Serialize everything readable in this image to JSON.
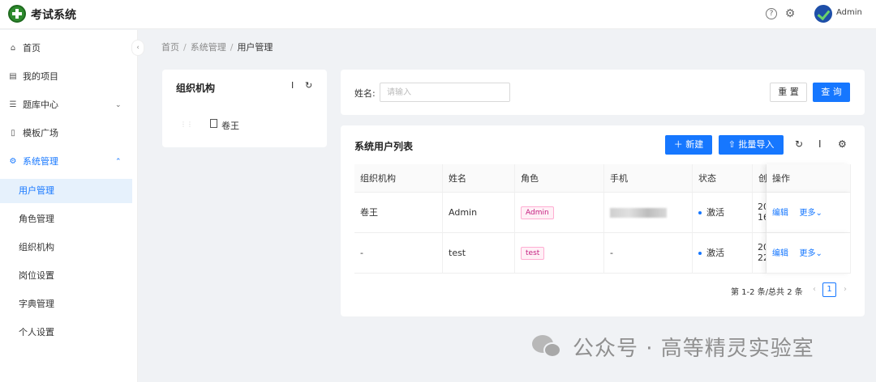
{
  "header": {
    "app_title": "考试系统",
    "user_name": "Admin",
    "help_icon": "help-circle-icon",
    "settings_icon": "gear-icon"
  },
  "sidebar": {
    "items": [
      {
        "label": "首页",
        "icon": "home-icon"
      },
      {
        "label": "我的项目",
        "icon": "project-icon"
      },
      {
        "label": "题库中心",
        "icon": "question-bank-icon"
      },
      {
        "label": "模板广场",
        "icon": "template-icon"
      },
      {
        "label": "系统管理",
        "icon": "settings-icon"
      }
    ],
    "sub_items": [
      {
        "label": "用户管理"
      },
      {
        "label": "角色管理"
      },
      {
        "label": "组织机构"
      },
      {
        "label": "岗位设置"
      },
      {
        "label": "字典管理"
      },
      {
        "label": "个人设置"
      }
    ]
  },
  "breadcrumb": {
    "home": "首页",
    "parent": "系统管理",
    "current": "用户管理"
  },
  "org_panel": {
    "title": "组织机构",
    "tree": [
      {
        "label": "卷王"
      }
    ]
  },
  "search": {
    "label": "姓名:",
    "placeholder": "请输入",
    "value": "",
    "reset_label": "重 置",
    "query_label": "查 询"
  },
  "table_panel": {
    "title": "系统用户列表",
    "new_label": "新建",
    "import_label": "批量导入",
    "columns": [
      "组织机构",
      "姓名",
      "角色",
      "手机",
      "状态",
      "创",
      "操作"
    ],
    "rows": [
      {
        "org": "卷王",
        "name": "Admin",
        "role": "Admin",
        "phone": "",
        "status": "激活",
        "created": "20",
        "created2": "16",
        "edit": "编辑",
        "more": "更多"
      },
      {
        "org": "-",
        "name": "test",
        "role": "test",
        "phone": "-",
        "status": "激活",
        "created": "20",
        "created2": "22",
        "edit": "编辑",
        "more": "更多"
      }
    ],
    "pagination": {
      "total_text": "第 1-2 条/总共 2 条",
      "current_page": "1"
    }
  },
  "watermark": {
    "text": "公众号 · 高等精灵实验室"
  }
}
